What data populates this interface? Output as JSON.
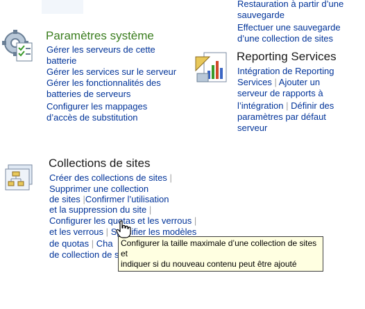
{
  "backup": {
    "link1_line1": "Restauration à partir d’une",
    "link1_line2": "sauvegarde",
    "link2_line1": "Effectuer une sauvegarde",
    "link2_line2": "d’une collection de sites"
  },
  "system_settings": {
    "title": "Paramètres système",
    "links": [
      [
        "Gérer les serveurs de cette",
        "batterie"
      ],
      [
        "Gérer les services sur le serveur"
      ],
      [
        "Gérer les fonctionnalités des",
        "batteries de serveurs"
      ],
      [
        "Configurer les mappages",
        "d’accès de substitution"
      ]
    ]
  },
  "reporting_services": {
    "title": "Reporting Services",
    "line1": "Intégration de Reporting",
    "line2a": "Services",
    "sep": "|",
    "line2b": "Ajouter un",
    "line3": "serveur de rapports à",
    "line4a": "l’intégration",
    "line4b": "Définir des",
    "line5": "paramètres par défaut",
    "line6": "serveur"
  },
  "site_collections": {
    "title": "Collections de sites",
    "l1": "Créer des collections de sites",
    "l2": "Supprimer une collection",
    "l3a": "de sites",
    "l3b": "Confirmer l’utilisation",
    "l4": "et la suppression du site",
    "l5": "Configurer les quotas et les verrous",
    "l6a": "et les verrous",
    "l6b": "Spécifier les modèles",
    "l7a": "de quotas",
    "l7b": "Cha",
    "l8": "de collection de sites",
    "sep": "|"
  },
  "tooltip": {
    "line1": "Configurer la taille maximale d’une collection de sites et",
    "line2": "indiquer si du nouveau contenu peut être ajouté"
  }
}
